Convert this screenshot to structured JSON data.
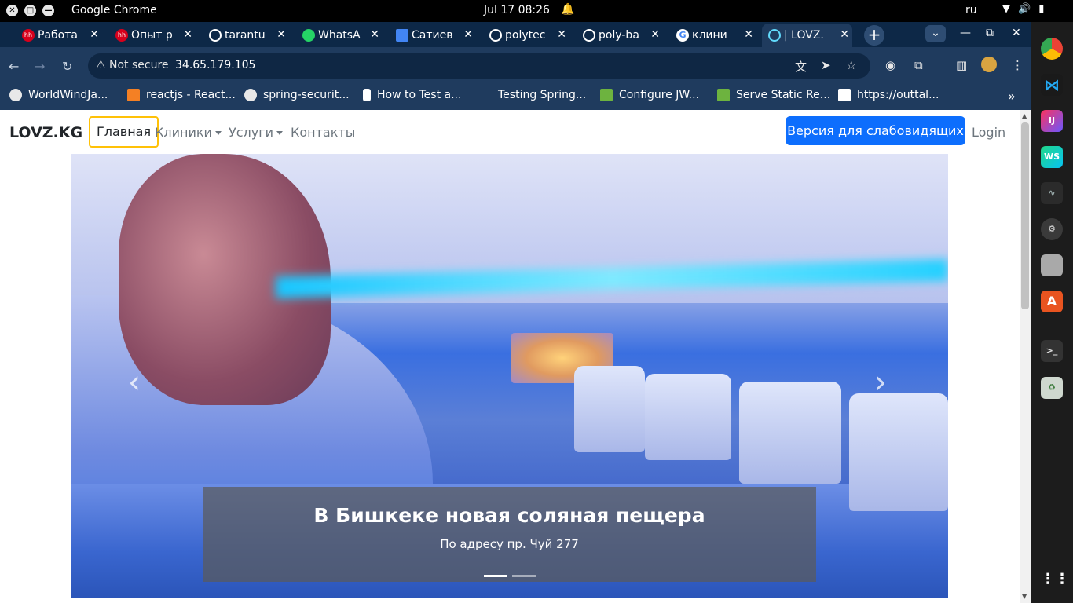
{
  "system_bar": {
    "app_name": "Google Chrome",
    "clock": "Jul 17  08:26",
    "language": "ru"
  },
  "tabs": [
    {
      "label": "Работа",
      "icon": "hh-icon",
      "color": "#d6001c"
    },
    {
      "label": "Опыт р",
      "icon": "hh-icon",
      "color": "#d6001c"
    },
    {
      "label": "tarantu",
      "icon": "github-icon",
      "color": "#ffffff"
    },
    {
      "label": "WhatsA",
      "icon": "whatsapp-icon",
      "color": "#25d366"
    },
    {
      "label": "Сатиев",
      "icon": "docs-icon",
      "color": "#4285f4"
    },
    {
      "label": "polytec",
      "icon": "github-icon",
      "color": "#ffffff"
    },
    {
      "label": "poly-ba",
      "icon": "github-icon",
      "color": "#ffffff"
    },
    {
      "label": "клини",
      "icon": "google-icon",
      "color": "#ffffff"
    },
    {
      "label": "| LOVZ.",
      "icon": "react-icon",
      "color": "#61dafb"
    }
  ],
  "toolbar": {
    "security_label": "Not secure",
    "url": "34.65.179.105"
  },
  "bookmarks": [
    {
      "label": "WorldWindJa..."
    },
    {
      "label": "reactjs - React..."
    },
    {
      "label": "spring-securit..."
    },
    {
      "label": "How to Test a..."
    },
    {
      "label": "Testing Spring..."
    },
    {
      "label": "Configure JW..."
    },
    {
      "label": "Serve Static Re..."
    },
    {
      "label": "https://outtal..."
    }
  ],
  "site": {
    "brand": "LOVZ.KG",
    "nav": {
      "home": "Главная",
      "clinics": "Клиники",
      "services": "Услуги",
      "contacts": "Контакты"
    },
    "accessibility_button": "Версия для слабовидящих",
    "login": "Login",
    "carousel": {
      "caption_title": "В Бишкеке новая соляная пещера",
      "caption_text": "По адресу пр. Чуй 277",
      "slide_count": 2,
      "active_slide": 1
    }
  },
  "colors": {
    "primary_button": "#0d6efd",
    "active_nav_border": "#ffc107",
    "tab_strip": "#0d2847",
    "toolbar": "#1f3b5e"
  }
}
